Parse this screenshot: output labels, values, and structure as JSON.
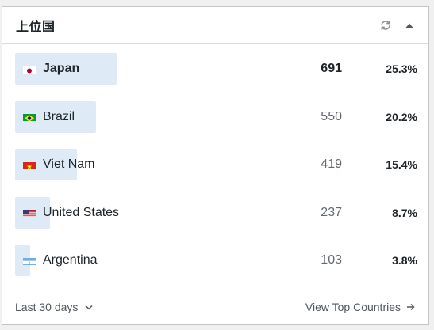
{
  "widget": {
    "title": "上位国",
    "refresh_icon": "refresh-icon",
    "collapse_icon": "caret-up-icon"
  },
  "countries": [
    {
      "name": "Japan",
      "flag": "flag-japan",
      "count": "691",
      "percent": "25.3%",
      "share": 25.3,
      "top": true
    },
    {
      "name": "Brazil",
      "flag": "flag-brazil",
      "count": "550",
      "percent": "20.2%",
      "share": 20.2,
      "top": false
    },
    {
      "name": "Viet Nam",
      "flag": "flag-vietnam",
      "count": "419",
      "percent": "15.4%",
      "share": 15.4,
      "top": false
    },
    {
      "name": "United States",
      "flag": "flag-united-states",
      "count": "237",
      "percent": "8.7%",
      "share": 8.7,
      "top": false
    },
    {
      "name": "Argentina",
      "flag": "flag-argentina",
      "count": "103",
      "percent": "3.8%",
      "share": 3.8,
      "top": false
    }
  ],
  "footer": {
    "period_label": "Last 30 days",
    "view_link": "View Top Countries"
  },
  "colors": {
    "bar": "#deebf7",
    "text": "#1d2327",
    "muted": "#646970"
  }
}
